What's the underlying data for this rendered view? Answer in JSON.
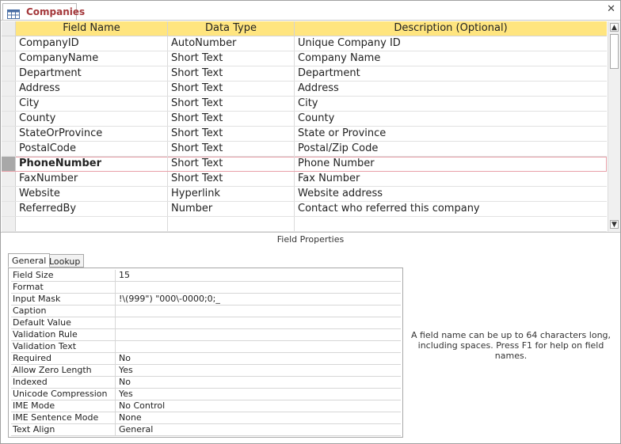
{
  "document_tab": {
    "title": "Companies",
    "icon": "table-icon",
    "close_icon": "close-icon",
    "close_glyph": "✕"
  },
  "grid": {
    "columns": [
      "Field Name",
      "Data Type",
      "Description (Optional)"
    ],
    "rows": [
      {
        "field": "CompanyID",
        "type": "AutoNumber",
        "desc": "Unique Company ID"
      },
      {
        "field": "CompanyName",
        "type": "Short Text",
        "desc": "Company Name"
      },
      {
        "field": "Department",
        "type": "Short Text",
        "desc": "Department"
      },
      {
        "field": "Address",
        "type": "Short Text",
        "desc": "Address"
      },
      {
        "field": "City",
        "type": "Short Text",
        "desc": "City"
      },
      {
        "field": "County",
        "type": "Short Text",
        "desc": "County"
      },
      {
        "field": "StateOrProvince",
        "type": "Short Text",
        "desc": "State or Province"
      },
      {
        "field": "PostalCode",
        "type": "Short Text",
        "desc": "Postal/Zip Code"
      },
      {
        "field": "PhoneNumber",
        "type": "Short Text",
        "desc": "Phone Number"
      },
      {
        "field": "FaxNumber",
        "type": "Short Text",
        "desc": "Fax Number"
      },
      {
        "field": "Website",
        "type": "Hyperlink",
        "desc": "Website address"
      },
      {
        "field": "ReferredBy",
        "type": "Number",
        "desc": "Contact who referred this company"
      },
      {
        "field": "",
        "type": "",
        "desc": ""
      }
    ],
    "selected_row": 8,
    "header_color": "#ffe57f",
    "selection_outline": "#e8a0a8"
  },
  "scrollbar": {
    "up_glyph": "▲",
    "down_glyph": "▼"
  },
  "field_properties": {
    "title": "Field Properties",
    "tabs": [
      "General",
      "Lookup"
    ],
    "active_tab": 0,
    "properties": [
      {
        "name": "Field Size",
        "value": "15"
      },
      {
        "name": "Format",
        "value": ""
      },
      {
        "name": "Input Mask",
        "value": "!\\(999\") \"000\\-0000;0;_"
      },
      {
        "name": "Caption",
        "value": ""
      },
      {
        "name": "Default Value",
        "value": ""
      },
      {
        "name": "Validation Rule",
        "value": ""
      },
      {
        "name": "Validation Text",
        "value": ""
      },
      {
        "name": "Required",
        "value": "No"
      },
      {
        "name": "Allow Zero Length",
        "value": "Yes"
      },
      {
        "name": "Indexed",
        "value": "No"
      },
      {
        "name": "Unicode Compression",
        "value": "Yes"
      },
      {
        "name": "IME Mode",
        "value": "No Control"
      },
      {
        "name": "IME Sentence Mode",
        "value": "None"
      },
      {
        "name": "Text Align",
        "value": "General"
      }
    ],
    "help_text": "A field name can be up to 64 characters long, including spaces. Press F1 for help on field names."
  }
}
